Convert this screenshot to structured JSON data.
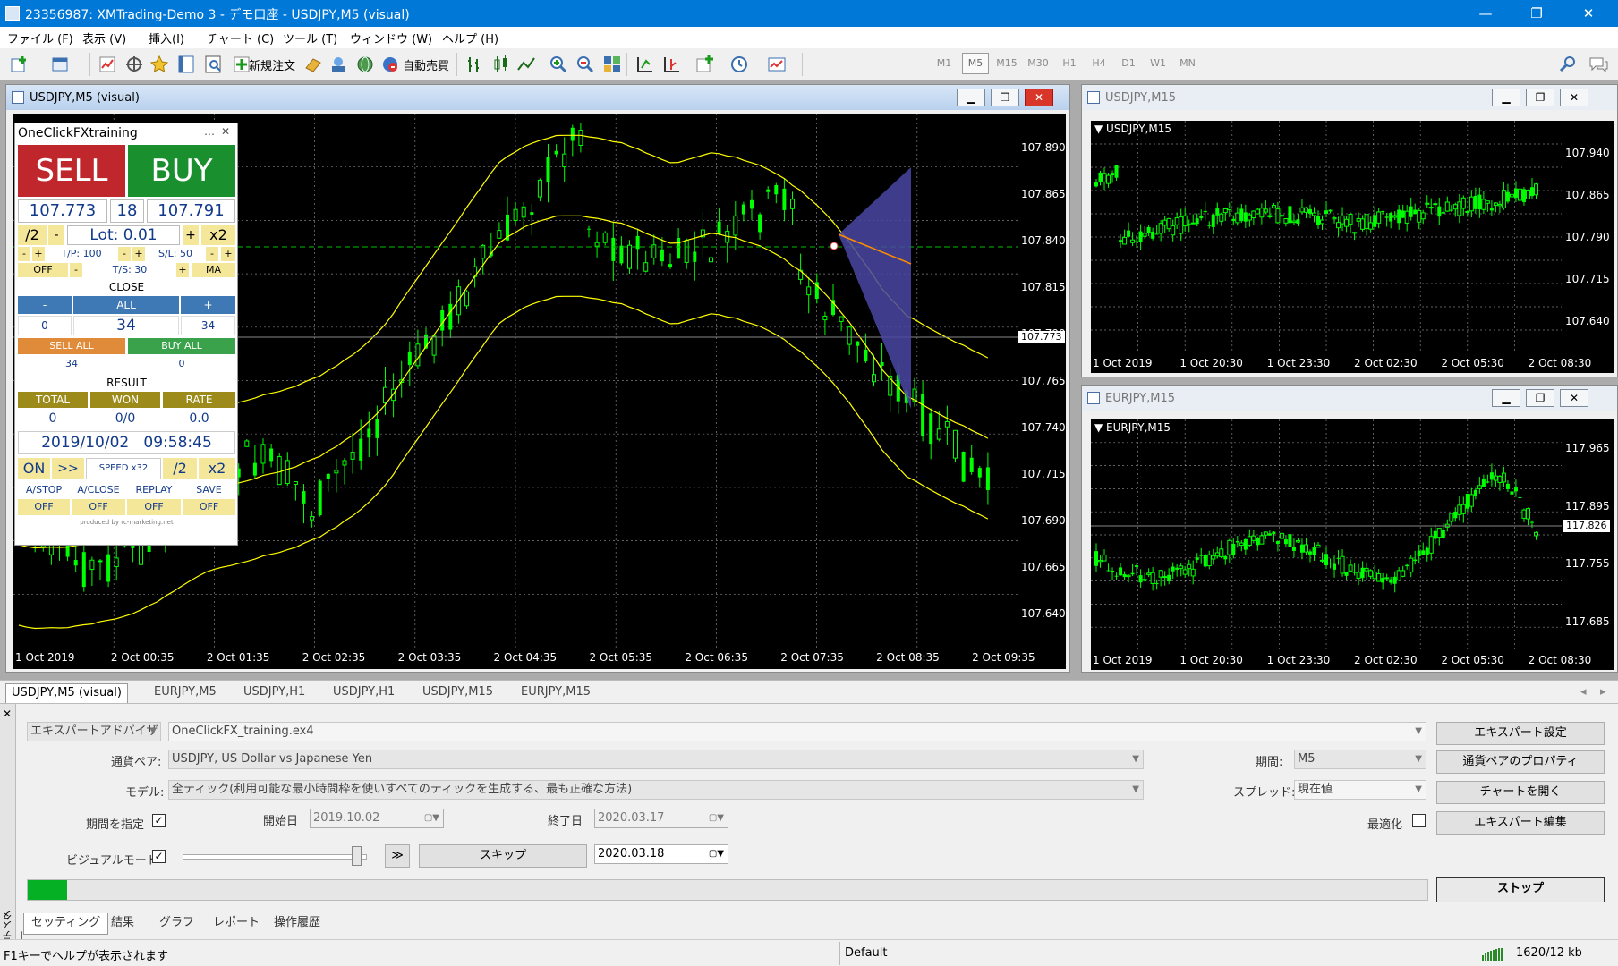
{
  "window": {
    "title": "23356987: XMTrading-Demo 3 - デモ口座 - USDJPY,M5 (visual)",
    "controls": {
      "minimize": "—",
      "maximize": "❐",
      "close": "✕"
    }
  },
  "menu": [
    "ファイル (F)",
    "表示 (V)",
    "挿入(I)",
    "チャート (C)",
    "ツール (T)",
    "ウィンドウ (W)",
    "ヘルプ (H)"
  ],
  "toolbar": {
    "new_order": "新規注文",
    "auto_trade": "自動売買",
    "timeframes": [
      "M1",
      "M5",
      "M15",
      "M30",
      "H1",
      "H4",
      "D1",
      "W1",
      "MN"
    ],
    "selected_timeframe": "M5"
  },
  "colors": {
    "sell": "#c0272d",
    "buy": "#1a8f2e",
    "candle": "#00ff00",
    "bollinger": "#ffff00",
    "chart_bg": "#000000",
    "bid_line": "#00c000",
    "triangle": "#4a47a3"
  },
  "main_chart": {
    "window_title": "USDJPY,M5 (visual)",
    "current_price": "107.773",
    "y_labels": [
      "107.890",
      "107.865",
      "107.840",
      "107.815",
      "107.790",
      "107.765",
      "107.740",
      "107.715",
      "107.690",
      "107.665",
      "107.640"
    ],
    "x_labels": [
      "1 Oct 2019",
      "2 Oct 00:35",
      "2 Oct 01:35",
      "2 Oct 02:35",
      "2 Oct 03:35",
      "2 Oct 04:35",
      "2 Oct 05:35",
      "2 Oct 06:35",
      "2 Oct 07:35",
      "2 Oct 08:35",
      "2 Oct 09:35"
    ]
  },
  "chart_usdjpy_m15": {
    "window_title": "USDJPY,M15",
    "symbol_tag": "USDJPY,M15",
    "y_labels": [
      "107.940",
      "107.865",
      "107.790",
      "107.715",
      "107.640"
    ],
    "x_labels": [
      "1 Oct 2019",
      "1 Oct 20:30",
      "1 Oct 23:30",
      "2 Oct 02:30",
      "2 Oct 05:30",
      "2 Oct 08:30"
    ]
  },
  "chart_eurjpy_m15": {
    "window_title": "EURJPY,M15",
    "symbol_tag": "EURJPY,M15",
    "current_price": "117.826",
    "y_labels": [
      "117.965",
      "117.895",
      "117.755",
      "117.685"
    ],
    "x_labels": [
      "1 Oct 2019",
      "1 Oct 20:30",
      "1 Oct 23:30",
      "2 Oct 02:30",
      "2 Oct 05:30",
      "2 Oct 08:30"
    ]
  },
  "panel": {
    "title": "OneClickFXtraining",
    "sell": "SELL",
    "buy": "BUY",
    "bid": "107.773",
    "spread": "18",
    "ask": "107.791",
    "half": "/2",
    "minus": "-",
    "lot": "Lot: 0.01",
    "plus": "+",
    "double": "x2",
    "tp": "T/P: 100",
    "sl": "S/L: 50",
    "off": "OFF",
    "ts": "T/S: 30",
    "ma": "MA",
    "close_label": "CLOSE",
    "all": "ALL",
    "count_left": "0",
    "count_mid": "34",
    "count_right": "34",
    "sell_all": "SELL ALL",
    "buy_all": "BUY ALL",
    "sell_all_count": "34",
    "buy_all_count": "0",
    "result": "RESULT",
    "total": "TOTAL",
    "won": "WON",
    "rate": "RATE",
    "total_val": "0",
    "won_val": "0/0",
    "rate_val": "0.0",
    "datetime": "2019/10/02   09:58:45",
    "on": "ON",
    "fast": ">>",
    "speed": "SPEED x32",
    "astop": "A/STOP",
    "aclose": "A/CLOSE",
    "replay": "REPLAY",
    "save": "SAVE",
    "footer": "produced by rc-marketing.net"
  },
  "chart_tabs": [
    "USDJPY,M5 (visual)",
    "EURJPY,M5",
    "USDJPY,H1",
    "USDJPY,H1",
    "USDJPY,M15",
    "EURJPY,M15"
  ],
  "tester": {
    "side_label": "テスター",
    "close_x": "✕",
    "expert_type": "エキスパートアドバイザ",
    "expert_file": "OneClickFX_training.ex4",
    "pair_label": "通貨ペア:",
    "pair_value": "USDJPY, US Dollar vs Japanese Yen",
    "model_label": "モデル:",
    "model_value": "全ティック(利用可能な最小時間枠を使いすべてのティックを生成する、最も正確な方法)",
    "period_label": "期間:",
    "period_value": "M5",
    "spread_label": "スプレッド:",
    "spread_value": "現在値",
    "use_date_label": "期間を指定",
    "start_label": "開始日",
    "start_value": "2019.10.02",
    "end_label": "終了日",
    "end_value": "2020.03.17",
    "visual_label": "ビジュアルモード",
    "ff_button": "≫",
    "skip_button": "スキップ",
    "skip_date": "2020.03.18",
    "optimize_label": "最適化",
    "btn_expert_settings": "エキスパート設定",
    "btn_symbol_props": "通貨ペアのプロパティ",
    "btn_open_chart": "チャートを開く",
    "btn_edit_expert": "エキスパート編集",
    "btn_stop": "ストップ",
    "progress": 0.028,
    "bottom_tabs": [
      "セッティング",
      "結果",
      "グラフ",
      "レポート",
      "操作履歴"
    ]
  },
  "status": {
    "help": "F1キーでヘルプが表示されます",
    "profile": "Default",
    "traffic": "1620/12 kb"
  }
}
